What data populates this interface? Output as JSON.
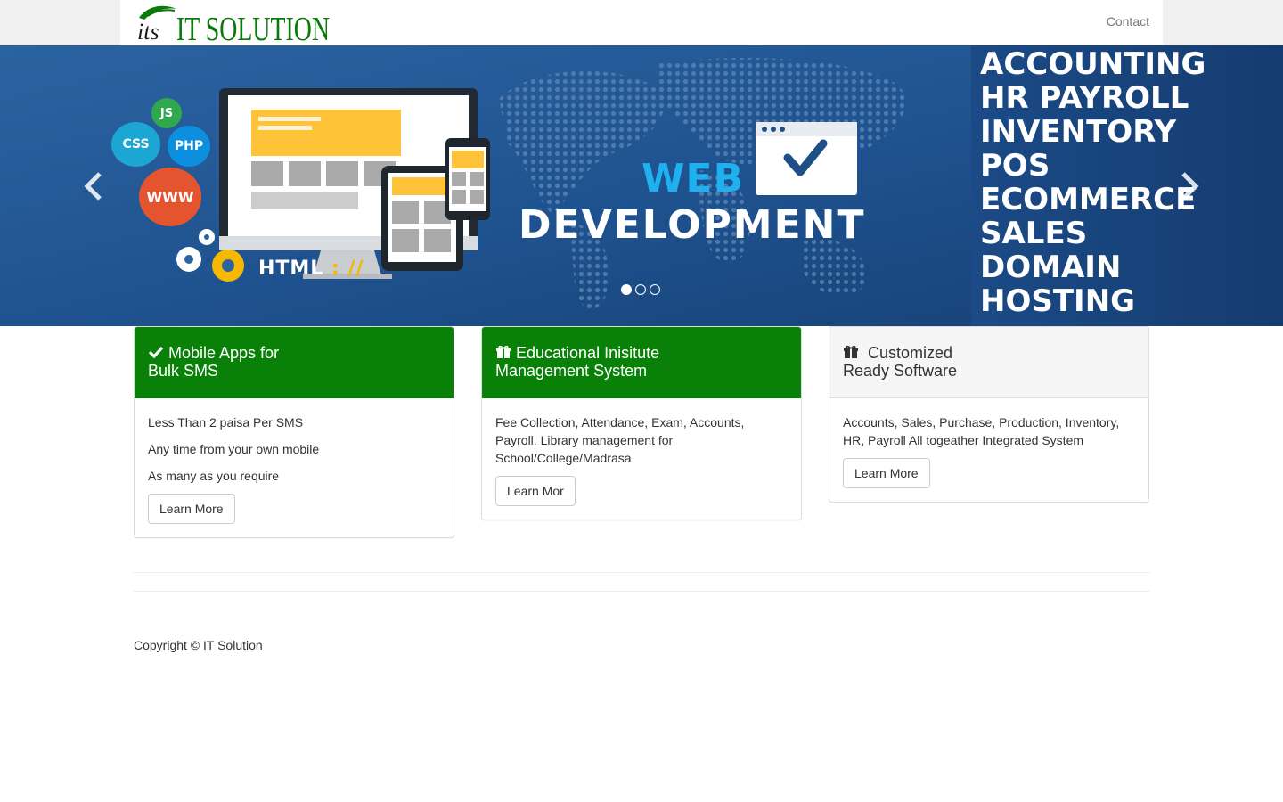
{
  "brand": {
    "logo_mark": "its",
    "logo_text": "IT SOLUTION",
    "logo_alt": "IT Solution logo"
  },
  "navbar": {
    "contact_label": "Contact"
  },
  "carousel": {
    "slide_index": 1,
    "slide_count": 3,
    "headline_top": "WEB",
    "headline_bottom": "DEVELOPMENT",
    "html_label": "HTML",
    "html_sep": " : //",
    "tech_badges": [
      "JS",
      "CSS",
      "PHP",
      "WWW"
    ],
    "services": [
      "ACCOUNTING",
      "HR PAYROLL",
      "INVENTORY",
      "POS",
      "ECOMMERCE",
      "SALES",
      "DOMAIN",
      "HOSTING"
    ],
    "prev_icon": "chevron-left-icon",
    "next_icon": "chevron-right-icon",
    "colors": {
      "background": "#1e4f86",
      "accent_blue": "#1fb0f0",
      "accent_yellow": "#f6b800"
    }
  },
  "panels": [
    {
      "heading_line1": "Mobile Apps for",
      "heading_line2": "Bulk SMS",
      "icon": "check-icon",
      "style": "green",
      "body": [
        "Less Than 2 paisa Per SMS",
        "Any time from your own mobile",
        "As many as you require"
      ],
      "button": "Learn More"
    },
    {
      "heading_line1": "Educational Inisitute",
      "heading_line2": "Management System",
      "icon": "gift-icon",
      "style": "green",
      "body": [
        "Fee Collection, Attendance, Exam, Accounts, Payroll. Library management for School/College/Madrasa"
      ],
      "button": "Learn Mor"
    },
    {
      "heading_line1": "Customized",
      "heading_line2": "Ready Software",
      "icon": "gift-icon",
      "style": "grey",
      "body": [
        "Accounts, Sales, Purchase, Production, Inventory, HR, Payroll All togeather Integrated System"
      ],
      "button": "Learn More"
    }
  ],
  "footer": {
    "copyright": "Copyright © IT Solution"
  },
  "theme": {
    "panel_green": "#098109",
    "link_grey": "#777777"
  }
}
